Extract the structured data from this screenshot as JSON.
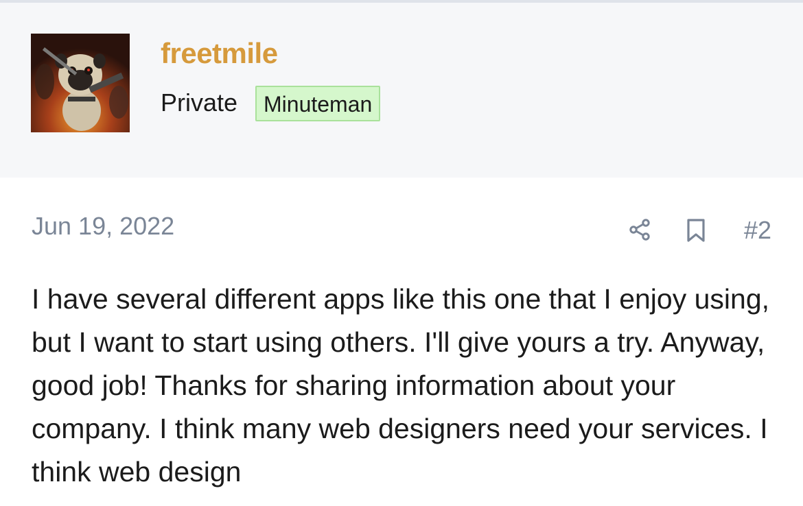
{
  "post": {
    "author": {
      "username": "freetmile",
      "title": "Private",
      "badge": "Minuteman",
      "avatar_icon": "pug-avatar"
    },
    "date": "Jun 19, 2022",
    "number": "#2",
    "actions": {
      "share_icon": "share-icon",
      "bookmark_icon": "bookmark-icon"
    },
    "body": "I have several different apps like this one that I enjoy using, but I want to start using others. I'll give yours a try. Anyway, good job! Thanks for sharing information about your company. I think many web designers need your services. I think web design"
  },
  "colors": {
    "username": "#d69a3c",
    "header_bg": "#f6f7f9",
    "badge_bg": "#d5f7cc",
    "badge_border": "#a9e19b",
    "meta_text": "#7a8596",
    "body_text": "#1b1b1b"
  }
}
